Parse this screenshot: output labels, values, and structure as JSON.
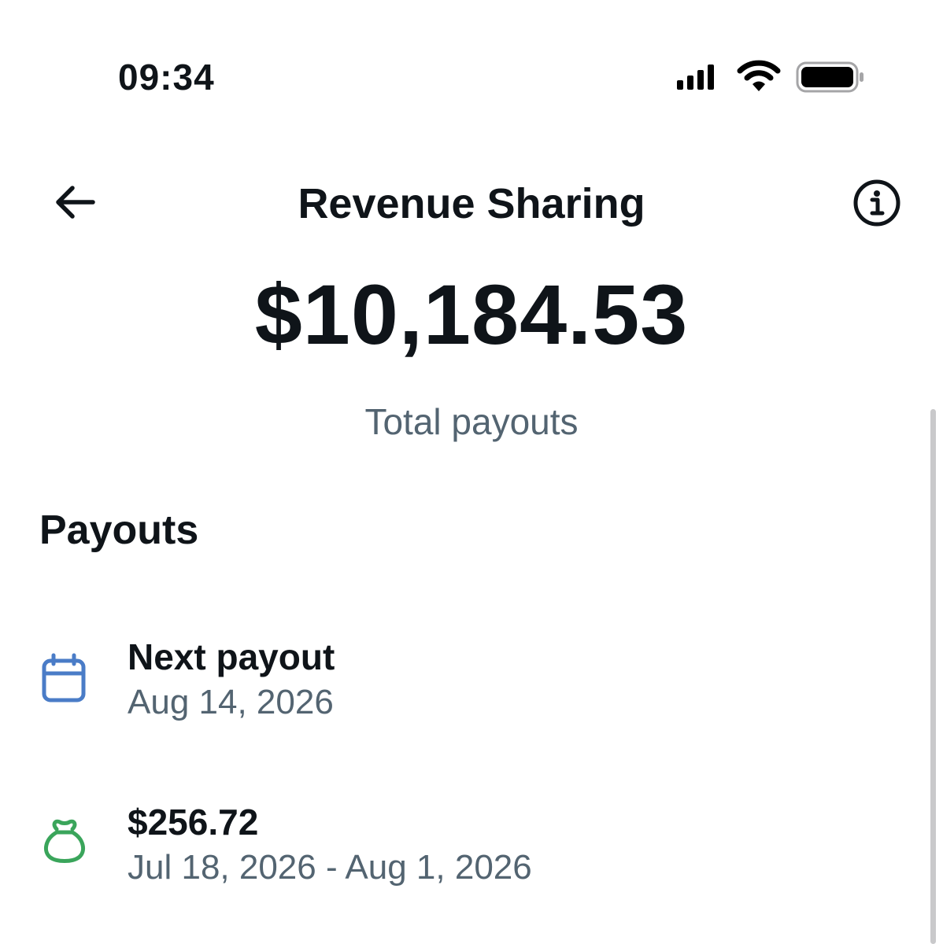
{
  "status_bar": {
    "time": "09:34",
    "icons": [
      "signal-icon",
      "wifi-icon",
      "battery-icon"
    ]
  },
  "header": {
    "title": "Revenue Sharing",
    "back_icon": "arrow-left-icon",
    "info_icon": "info-icon"
  },
  "summary": {
    "total_amount": "$10,184.53",
    "total_label": "Total payouts"
  },
  "payouts": {
    "heading": "Payouts",
    "items": [
      {
        "icon": "calendar-icon",
        "icon_color": "#4a7cc7",
        "title": "Next payout",
        "subtitle": "Aug 14, 2026"
      },
      {
        "icon": "money-bag-icon",
        "icon_color": "#3aa55b",
        "title": "$256.72",
        "subtitle": "Jul 18, 2026 - Aug 1, 2026"
      }
    ]
  },
  "colors": {
    "text_primary": "#0f1419",
    "text_secondary": "#536471"
  }
}
